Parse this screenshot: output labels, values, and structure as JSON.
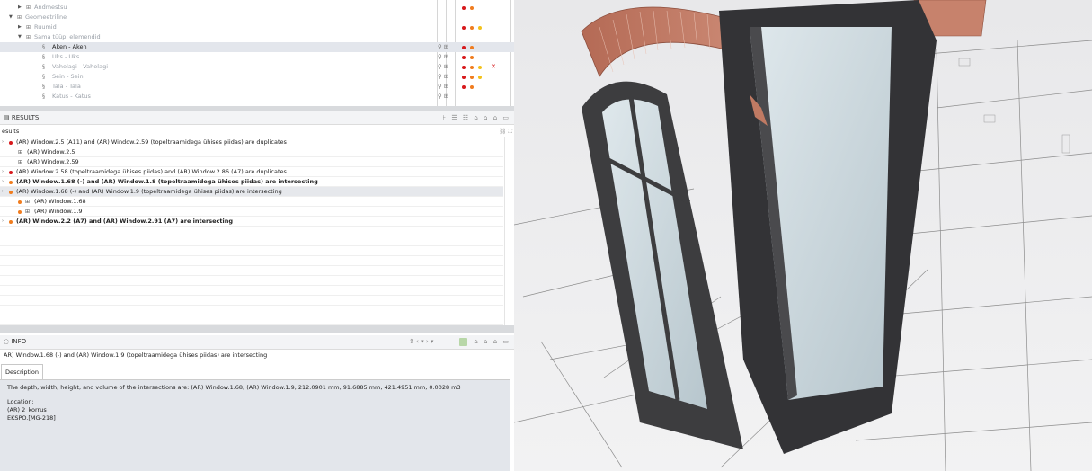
{
  "tree": {
    "rows": [
      {
        "label": "Andmestsu",
        "toggle": "▶",
        "dots": [
          "red",
          "orange"
        ]
      },
      {
        "label": "Geomeetriline",
        "toggle": "▼",
        "dots": []
      },
      {
        "label": "Ruumid",
        "toggle": "▶",
        "dots": [
          "red",
          "orange",
          "yellow"
        ]
      },
      {
        "label": "Sama tüüpi elemendid",
        "toggle": "▼",
        "dots": []
      },
      {
        "label": "Aken - Aken",
        "dots": [
          "red",
          "orange"
        ]
      },
      {
        "label": "Uks - Uks",
        "dots": [
          "red",
          "orange"
        ]
      },
      {
        "label": "Vahelagi - Vahelagi",
        "dots": [
          "red",
          "orange",
          "yellow"
        ],
        "x": "✕"
      },
      {
        "label": "Sein - Sein",
        "dots": [
          "red",
          "orange",
          "yellow"
        ]
      },
      {
        "label": "Tala - Tala",
        "dots": [
          "red",
          "orange"
        ]
      },
      {
        "label": "Katus - Katus",
        "dots": []
      }
    ],
    "family_glyph": "⊞",
    "section_glyph": "§",
    "tool_glyphs": "⚲ ⊞"
  },
  "results": {
    "title": "RESULTS",
    "subheader": "esults",
    "header_icons": "⊦ ☰ ☷ ⌂ ⌂ ⌂ ▭",
    "sub_icons": "⛓ ⛶",
    "rows": [
      {
        "text": "(AR) Window.2.5 (A11) and (AR) Window.2.59 (topeltraamidega ühises piidas) are duplicates",
        "level": 0,
        "dot": "red",
        "bold": false
      },
      {
        "text": "(AR) Window.2.5",
        "level": 1,
        "bold": false
      },
      {
        "text": "(AR) Window.2.59",
        "level": 1,
        "bold": false
      },
      {
        "text": "(AR) Window.2.58 (topeltraamidega ühises piidas) and (AR) Window.2.86 (A7) are duplicates",
        "level": 0,
        "dot": "red",
        "bold": false
      },
      {
        "text": "(AR) Window.1.68 (-) and (AR) Window.1.8 (topeltraamidega ühises piidas) are intersecting",
        "level": 0,
        "dot": "orange",
        "bold": true
      },
      {
        "text": "(AR) Window.1.68 (-) and (AR) Window.1.9 (topeltraamidega ühises piidas) are intersecting",
        "level": 0,
        "dot": "orange",
        "bold": false,
        "highlight": true
      },
      {
        "text": "(AR) Window.1.68",
        "level": 1,
        "dot": "orange",
        "bold": false
      },
      {
        "text": "(AR) Window.1.9",
        "level": 1,
        "dot": "orange",
        "bold": false
      },
      {
        "text": "(AR) Window.2.2 (A7) and (AR) Window.2.91 (A7) are intersecting",
        "level": 0,
        "dot": "orange",
        "bold": true
      }
    ]
  },
  "info": {
    "title": "INFO",
    "nav": "⇕ ‹ ▾ › ▾",
    "icons": "⌂ ⌂ ⌂ ▭",
    "heading": "AR) Window.1.68 (-) and (AR) Window.1.9 (topeltraamidega ühises piidas) are intersecting",
    "tab_label": "Description",
    "desc_line1": "The depth, width, height, and volume of the intersections are: (AR) Window.1.68, (AR) Window.1.9, 212.0901 mm, 91.6885 mm, 421.4951 mm, 0.0028 m3",
    "location_label": "Location:",
    "location_floor": "(AR) 2_korrus",
    "location_ref": "EKSPO.[MG-218]"
  },
  "colors": {
    "red": "#d7191c",
    "orange": "#f07c1e",
    "yellow": "#f2c21b",
    "selection": "#e3e6ec",
    "accent": "#2f6fd1"
  }
}
